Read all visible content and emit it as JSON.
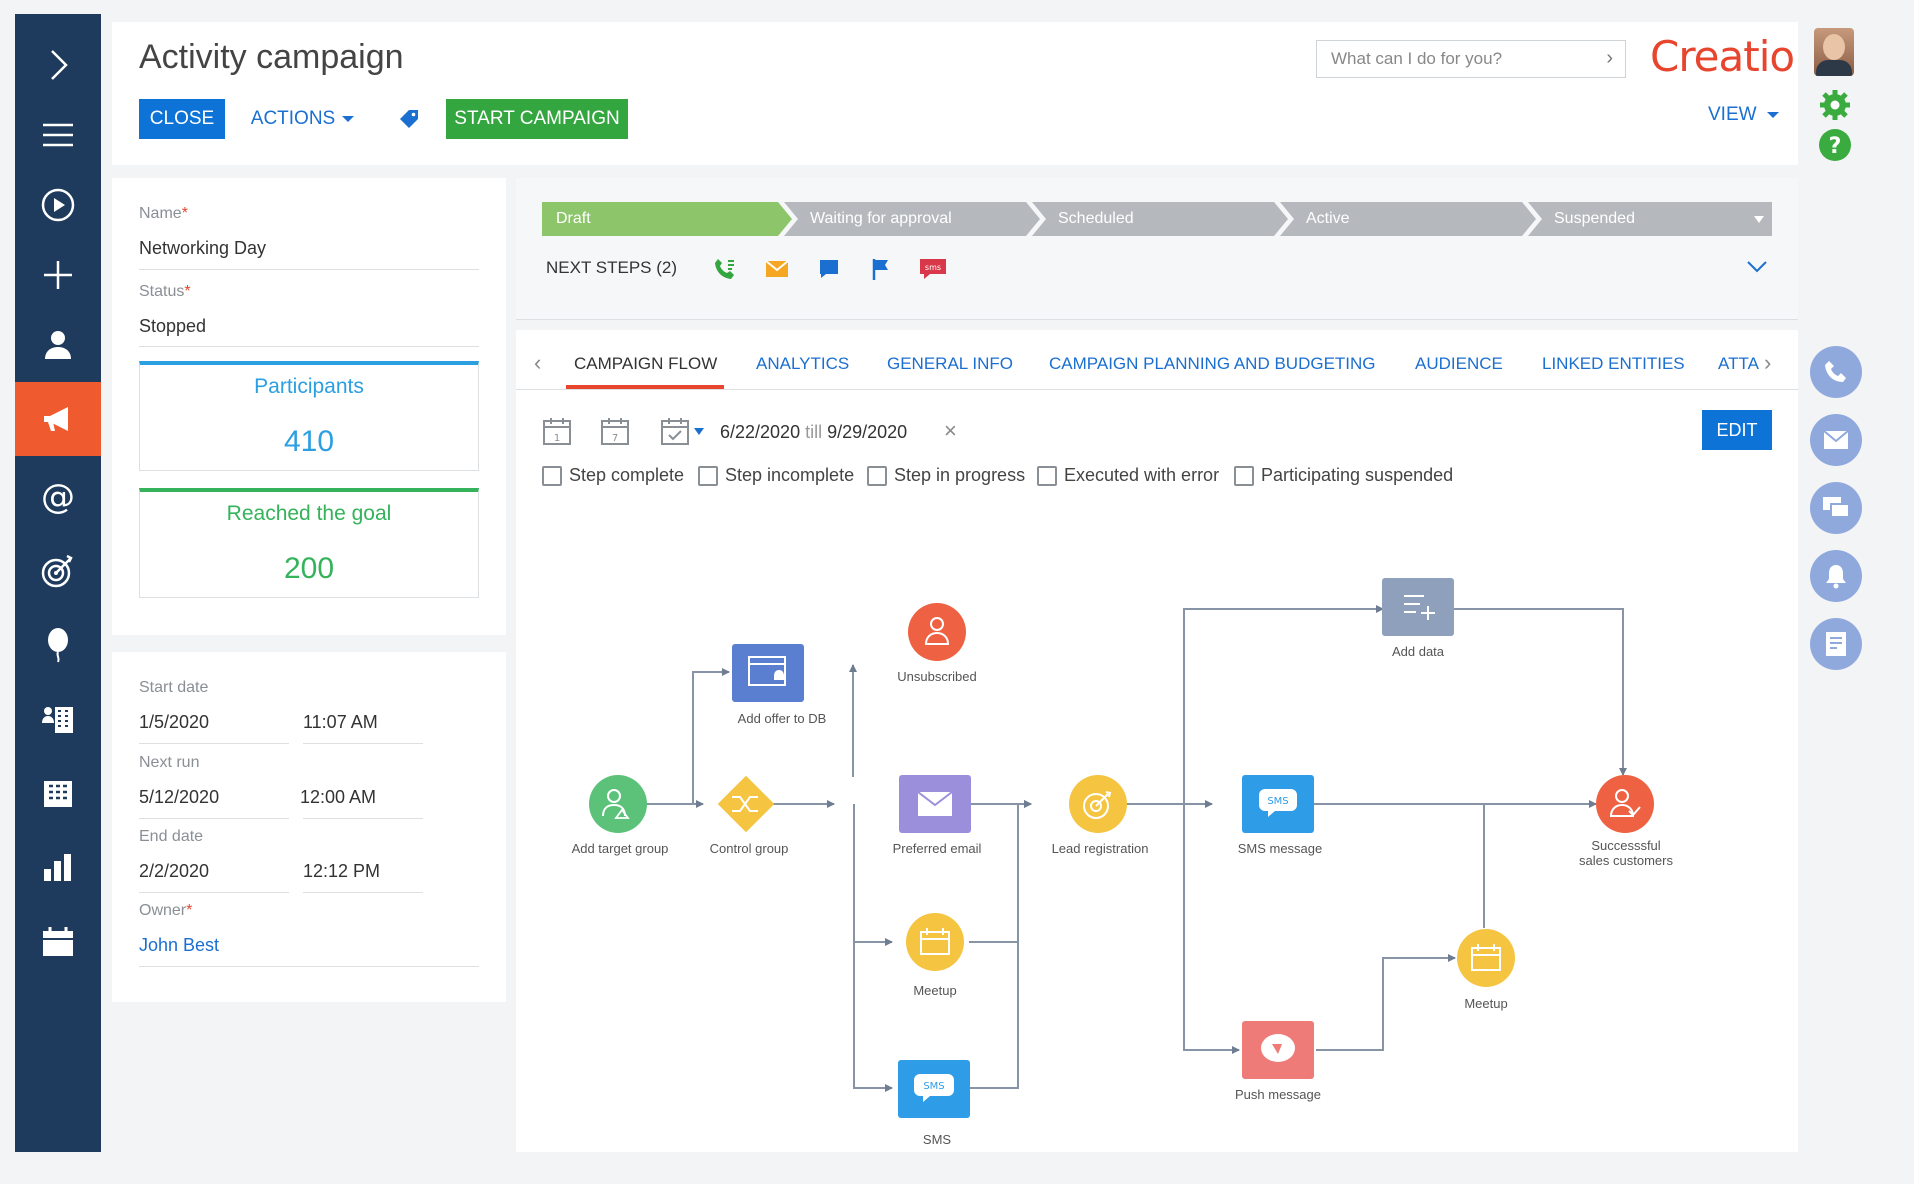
{
  "header": {
    "title": "Activity campaign",
    "close_label": "CLOSE",
    "actions_label": "ACTIONS",
    "start_label": "START CAMPAIGN",
    "search_placeholder": "What can I do for you?",
    "logo_text": "Creatio",
    "view_label": "VIEW"
  },
  "sidebar": {
    "items": [
      "collapse-icon",
      "menu-icon",
      "play-icon",
      "plus-icon",
      "contacts-icon",
      "campaigns-icon",
      "email-icon",
      "target-icon",
      "balloon-icon",
      "accounts-icon",
      "buildings-icon",
      "chart-icon",
      "calendar-icon"
    ],
    "active": "campaigns-icon"
  },
  "info": {
    "name_label": "Name",
    "name_value": "Networking Day",
    "status_label": "Status",
    "status_value": "Stopped",
    "participants_label": "Participants",
    "participants_value": "410",
    "goal_label": "Reached the goal",
    "goal_value": "200"
  },
  "dates": {
    "start_label": "Start date",
    "start_date": "1/5/2020",
    "start_time": "11:07 AM",
    "next_label": "Next run",
    "next_date": "5/12/2020",
    "next_time": "12:00 AM",
    "end_label": "End date",
    "end_date": "2/2/2020",
    "end_time": "12:12 PM",
    "owner_label": "Owner",
    "owner_value": "John Best"
  },
  "stages": [
    "Draft",
    "Waiting for approval",
    "Scheduled",
    "Active",
    "Suspended"
  ],
  "next_steps_label": "NEXT STEPS (2)",
  "tabs": [
    "CAMPAIGN FLOW",
    "ANALYTICS",
    "GENERAL INFO",
    "CAMPAIGN PLANNING AND BUDGETING",
    "AUDIENCE",
    "LINKED ENTITIES",
    "ATTA"
  ],
  "filter": {
    "date_from": "6/22/2020",
    "till": "till",
    "date_to": "9/29/2020",
    "edit_label": "EDIT",
    "checkboxes": [
      "Step complete",
      "Step incomplete",
      "Step in progress",
      "Executed with error",
      "Participating suspended"
    ]
  },
  "flow": {
    "nodes": {
      "add_target_group": "Add target group",
      "control_group": "Control group",
      "add_offer": "Add offer to DB",
      "unsubscribed": "Unsubscribed",
      "preferred_email": "Preferred email",
      "meetup1": "Meetup",
      "sms1": "SMS",
      "lead_registration": "Lead registration",
      "add_data": "Add  data",
      "sms_message": "SMS message",
      "push_message": "Push message",
      "meetup2": "Meetup",
      "success_1": "Successsful",
      "success_2": "sales customers"
    },
    "sms_badge": "SMS"
  },
  "colors": {
    "sidebar": "#1e3a5c",
    "accent": "#ef5a2f",
    "primary": "#0d73d6",
    "success": "#34a63f",
    "draft_stage": "#8dc56a",
    "stage_gray": "#b5b9bd"
  }
}
